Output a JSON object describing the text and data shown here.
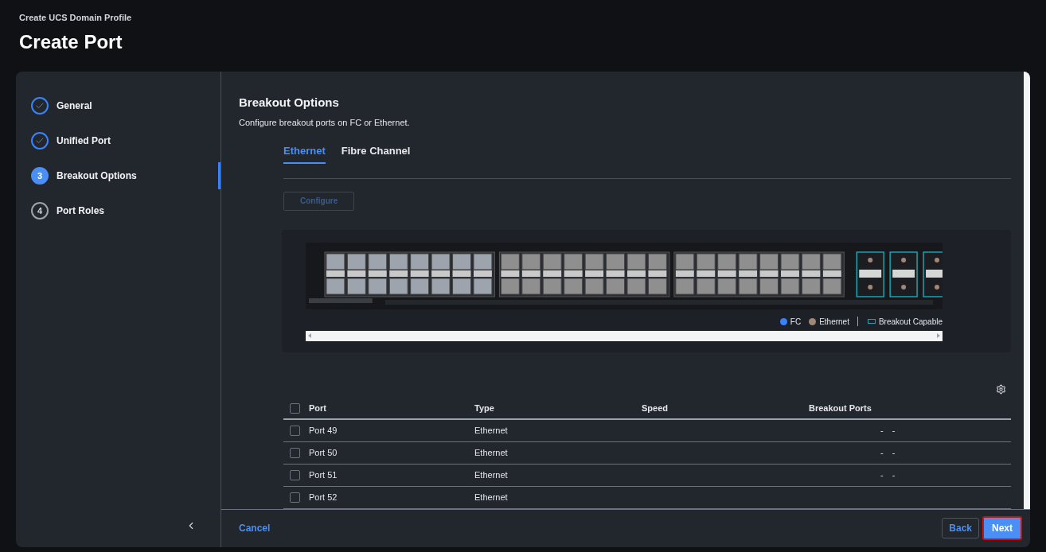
{
  "header": {
    "breadcrumb": "Create UCS Domain Profile",
    "title": "Create Port"
  },
  "steps": [
    {
      "label": "General",
      "kind": "done"
    },
    {
      "label": "Unified Port",
      "kind": "done"
    },
    {
      "number": "3",
      "label": "Breakout Options",
      "kind": "current"
    },
    {
      "number": "4",
      "label": "Port Roles",
      "kind": "pending"
    }
  ],
  "section": {
    "title": "Breakout Options",
    "description": "Configure breakout ports on FC or Ethernet."
  },
  "tabs": [
    {
      "label": "Ethernet",
      "selected": true
    },
    {
      "label": "Fibre Channel",
      "selected": false
    }
  ],
  "configure_button": {
    "label": "Configure",
    "disabled": true
  },
  "legend": [
    {
      "label": "FC",
      "kind": "dot",
      "color": "#3b82f6"
    },
    {
      "label": "Ethernet",
      "kind": "dot",
      "color": "#a08878"
    },
    {
      "label": "Breakout Capable",
      "kind": "outline",
      "color": "#1aa3b0"
    }
  ],
  "table": {
    "columns": [
      "Port",
      "Type",
      "Speed",
      "Breakout Ports"
    ],
    "header_checked": false,
    "rows": [
      {
        "port": "Port 49",
        "type": "Ethernet",
        "breakout": "- -",
        "checked": false
      },
      {
        "port": "Port 50",
        "type": "Ethernet",
        "breakout": "- -",
        "checked": false
      },
      {
        "port": "Port 51",
        "type": "Ethernet",
        "breakout": "- -",
        "checked": false
      },
      {
        "port": "Port 52",
        "type": "Ethernet",
        "checked": false
      }
    ]
  },
  "footer": {
    "cancel": "Cancel",
    "back": "Back",
    "next": "Next"
  }
}
